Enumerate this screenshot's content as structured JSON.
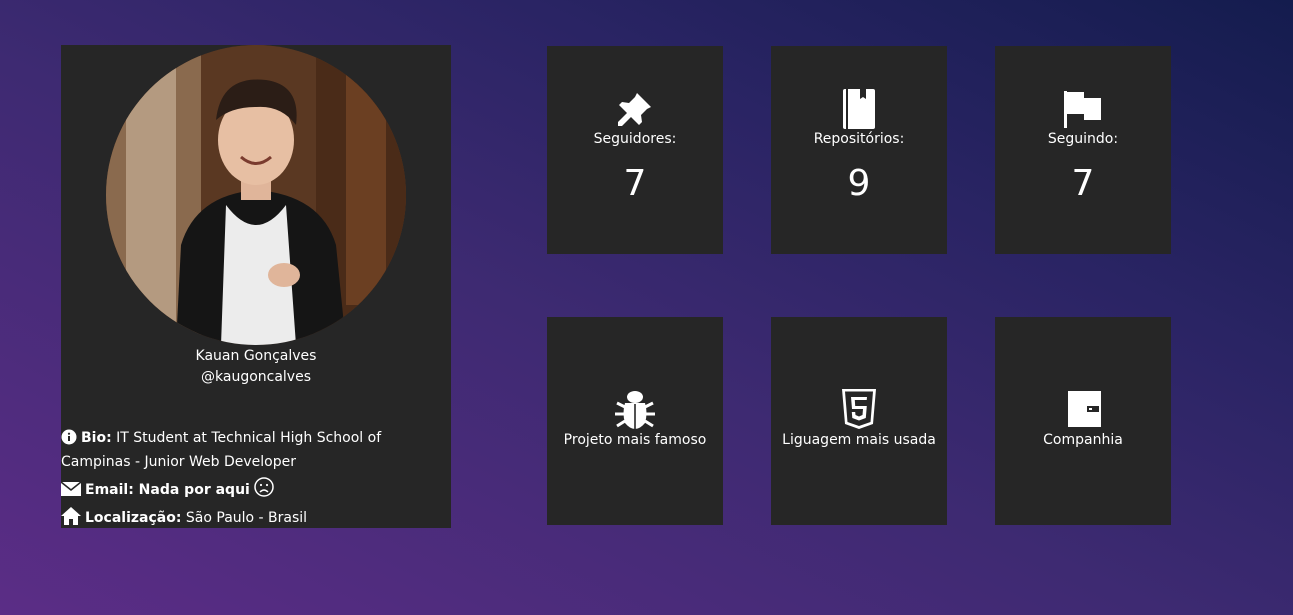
{
  "profile": {
    "name": "Kauan Gonçalves",
    "login": "@kaugoncalves",
    "bio_label": "Bio:",
    "bio_text": "IT Student at Technical High School of Campinas - Junior Web Developer",
    "email_label": "Email: Nada por aqui",
    "location_label": "Localização:",
    "location_text": "São Paulo - Brasil"
  },
  "stats": {
    "followers": {
      "label": "Seguidores:",
      "value": "7",
      "icon": "pushpin-icon"
    },
    "repos": {
      "label": "Repositórios:",
      "value": "9",
      "icon": "book-icon"
    },
    "following": {
      "label": "Seguindo:",
      "value": "7",
      "icon": "flag-icon"
    }
  },
  "extras": {
    "famous_project": {
      "label": "Projeto mais famoso",
      "icon": "bug-icon"
    },
    "top_language": {
      "label": "Liguagem mais usada",
      "icon": "html5-icon"
    },
    "company": {
      "label": "Companhia",
      "icon": "wallet-icon"
    }
  },
  "colors": {
    "card_bg": "#262626",
    "text": "#ffffff",
    "gradient_start": "#5b2d86",
    "gradient_end": "#141c4e"
  }
}
